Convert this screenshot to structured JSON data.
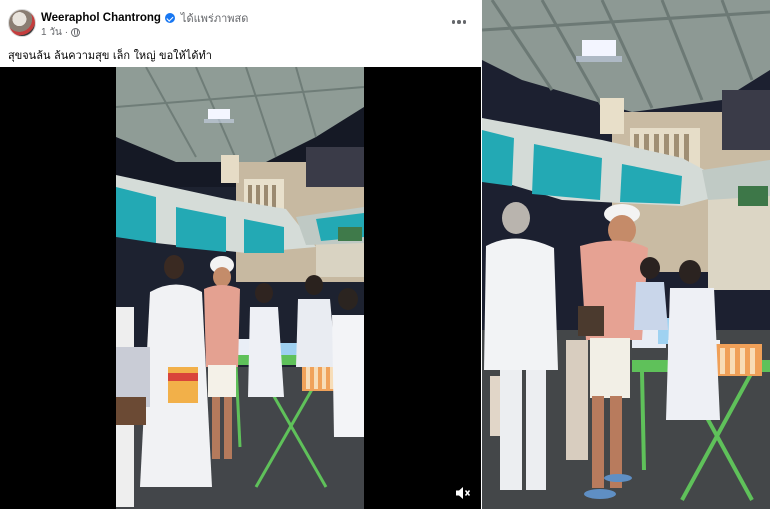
{
  "post": {
    "author": "Weeraphol Chantrong",
    "sponsor_label": "ได้แพร่ภาพสด",
    "time": "1 วัน",
    "separator": "·",
    "caption": "สุขจนล้น ล้นความสุข เล็ก ใหญ่  ขอให้ได้ทำ",
    "privacy_icon": "globe-icon",
    "verified_icon": "verified-badge-icon",
    "more_icon": "more-options-icon"
  },
  "video": {
    "mute_icon": "speaker-muted-icon"
  },
  "colors": {
    "verified": "#1877f2",
    "secondary_text": "#65676b",
    "awning_teal": "#23a9b4",
    "table_green": "#5fc15a"
  }
}
